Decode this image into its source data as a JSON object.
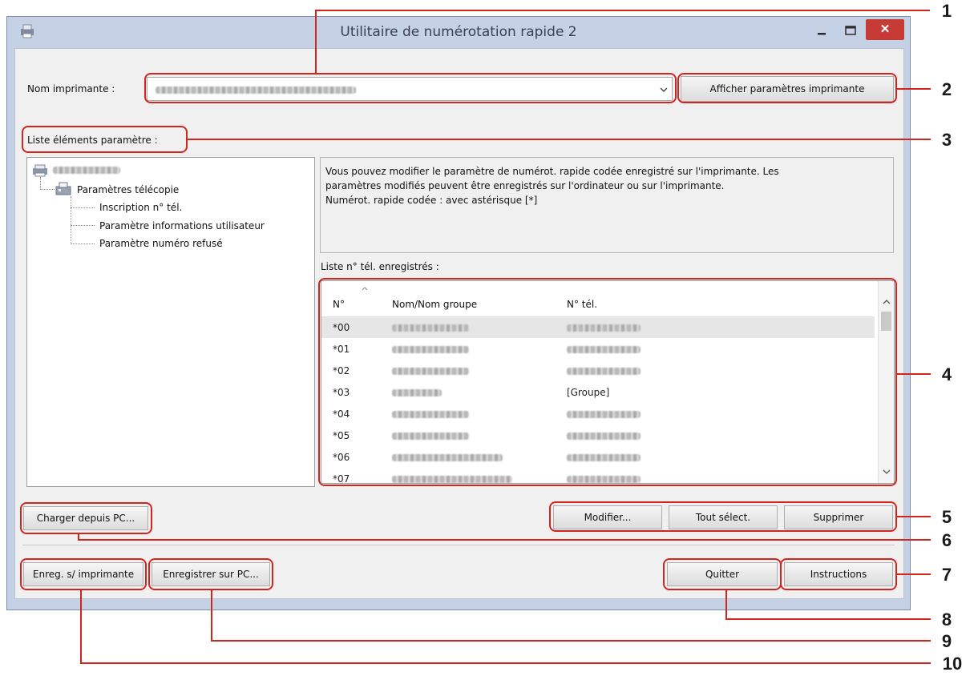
{
  "window": {
    "title": "Utilitaire de numérotation rapide 2",
    "close_glyph": "✕",
    "minimize_glyph": "–"
  },
  "printer": {
    "label": "Nom imprimante :",
    "show_settings_button": "Afficher paramètres imprimante"
  },
  "settings_list": {
    "label": "Liste éléments paramètre :",
    "tree": {
      "fax_settings": "Paramètres télécopie",
      "items": [
        "Inscription n° tél.",
        "Paramètre informations utilisateur",
        "Paramètre numéro refusé"
      ]
    }
  },
  "description": {
    "line1": "Vous pouvez modifier le paramètre de numérot. rapide codée enregistré sur l'imprimante. Les",
    "line2": "paramètres modifiés peuvent être enregistrés sur l'ordinateur ou sur l'imprimante.",
    "line3": "Numérot. rapide codée : avec astérisque [*]"
  },
  "registered_list": {
    "label": "Liste n° tél. enregistrés :",
    "columns": [
      "N°",
      "Nom/Nom groupe",
      "N° tél."
    ],
    "rows": [
      {
        "no": "*00",
        "phone": ""
      },
      {
        "no": "*01",
        "phone": ""
      },
      {
        "no": "*02",
        "phone": ""
      },
      {
        "no": "*03",
        "phone": "[Groupe]"
      },
      {
        "no": "*04",
        "phone": ""
      },
      {
        "no": "*05",
        "phone": ""
      },
      {
        "no": "*06",
        "phone": ""
      },
      {
        "no": "*07",
        "phone": ""
      }
    ]
  },
  "buttons": {
    "load_from_pc": "Charger depuis PC...",
    "edit": "Modifier...",
    "select_all": "Tout sélect.",
    "delete": "Supprimer",
    "save_to_printer": "Enreg. s/ imprimante",
    "save_to_pc": "Enregistrer sur PC...",
    "quit": "Quitter",
    "instructions": "Instructions"
  },
  "callouts": [
    "1",
    "2",
    "3",
    "4",
    "5",
    "6",
    "7",
    "8",
    "9",
    "10"
  ],
  "colors": {
    "callout": "#d3241e",
    "close_button": "#c73b36",
    "window_frame": "#c5d2e6"
  }
}
